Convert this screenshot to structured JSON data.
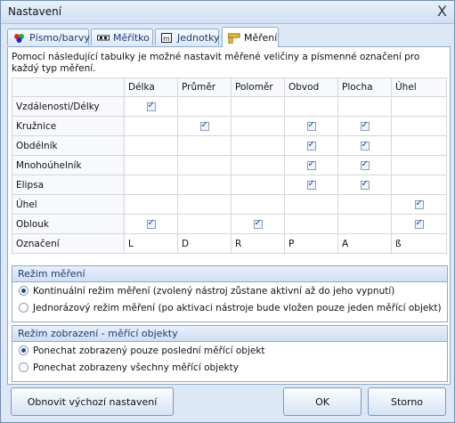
{
  "window": {
    "title": "Nastavení",
    "close": "X"
  },
  "tabs": [
    {
      "label": "Písmo/barvy",
      "icon": "color-dots-icon"
    },
    {
      "label": "Měřítko",
      "icon": "scale-icon"
    },
    {
      "label": "Jednotky",
      "icon": "units-icon"
    },
    {
      "label": "Měření",
      "icon": "ruler-icon"
    }
  ],
  "active_tab": "Měření",
  "description": "Pomocí následující tabulky je možné nastavit měřené veličiny a písmenné označení pro každý typ měření.",
  "table": {
    "columns": [
      "",
      "Délka",
      "Průměr",
      "Poloměr",
      "Obvod",
      "Plocha",
      "Úhel"
    ],
    "rows": [
      {
        "label": "Vzdálenosti/Délky",
        "checks": [
          true,
          false,
          false,
          false,
          false,
          false
        ]
      },
      {
        "label": "Kružnice",
        "checks": [
          false,
          true,
          false,
          true,
          true,
          false
        ]
      },
      {
        "label": "Obdélník",
        "checks": [
          false,
          false,
          false,
          true,
          true,
          false
        ]
      },
      {
        "label": "Mnohoúhelník",
        "checks": [
          false,
          false,
          false,
          true,
          true,
          false
        ]
      },
      {
        "label": "Elipsa",
        "checks": [
          false,
          false,
          false,
          true,
          true,
          false
        ]
      },
      {
        "label": "Úhel",
        "checks": [
          false,
          false,
          false,
          false,
          false,
          true
        ]
      },
      {
        "label": "Oblouk",
        "checks": [
          true,
          false,
          true,
          false,
          false,
          true
        ]
      }
    ],
    "designation_label": "Označení",
    "designations": [
      "L",
      "D",
      "R",
      "P",
      "A",
      "ß"
    ]
  },
  "measure_mode": {
    "title": "Režim měření",
    "options": [
      {
        "label": "Kontinuální režim měření (zvolený nástroj zůstane aktivní až do jeho vypnutí)",
        "selected": true
      },
      {
        "label": "Jednorázový režim měření (po aktivaci nástroje bude vložen pouze jeden měřící objekt)",
        "selected": false
      }
    ]
  },
  "display_mode": {
    "title": "Režim zobrazení - měřící objekty",
    "options": [
      {
        "label": "Ponechat zobrazený pouze poslední měřící objekt",
        "selected": true
      },
      {
        "label": "Ponechat zobrazeny všechny měřící objekty",
        "selected": false
      }
    ]
  },
  "buttons": {
    "reset": "Obnovit výchozí nastavení",
    "ok": "OK",
    "cancel": "Storno"
  }
}
